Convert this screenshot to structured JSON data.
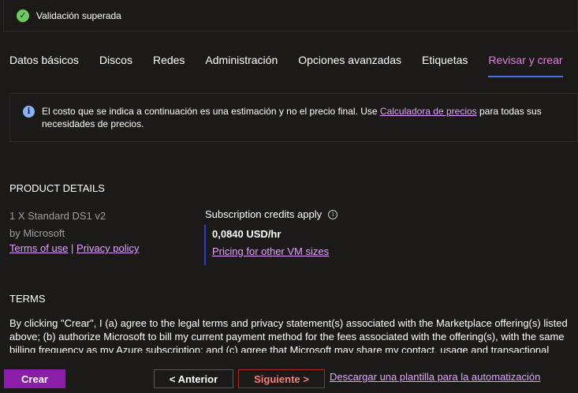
{
  "validation": {
    "text": "Validación superada"
  },
  "tabs": [
    {
      "label": "Datos básicos"
    },
    {
      "label": "Discos"
    },
    {
      "label": "Redes"
    },
    {
      "label": "Administración"
    },
    {
      "label": "Opciones avanzadas"
    },
    {
      "label": "Etiquetas"
    },
    {
      "label": "Revisar y crear"
    }
  ],
  "info": {
    "text_before": "El costo que se indica a continuación es una estimación y no el precio final. Use ",
    "link": "Calculadora de precios",
    "text_after": " para todas sus necesidades de precios."
  },
  "product": {
    "heading": "PRODUCT DETAILS",
    "name": "1 X Standard DS1 v2",
    "publisher": "by Microsoft",
    "terms_link": "Terms of use",
    "separator": " | ",
    "privacy_link": "Privacy policy",
    "credits_label": "Subscription credits apply",
    "price": "0,0840 USD/hr",
    "pricing_link": "Pricing for other VM sizes"
  },
  "terms": {
    "heading": "TERMS",
    "body": "By clicking \"Crear\", I (a) agree to the legal terms and privacy statement(s) associated with the Marketplace offering(s) listed above; (b) authorize Microsoft to bill my current payment method for the fees associated with the offering(s), with the same billing frequency as my Azure subscription; and (c) agree that Microsoft may share my contact, usage and transactional"
  },
  "footer": {
    "create": "Crear",
    "previous": "< Anterior",
    "next": "Siguiente >",
    "download": "Descargar una plantilla para la automatización"
  },
  "colors": {
    "accent": "#e27fe1",
    "link": "#e3a2ff",
    "create_button": "#8a1ea8",
    "success": "#6ccb5f",
    "price_bar": "#2b3bd6"
  }
}
